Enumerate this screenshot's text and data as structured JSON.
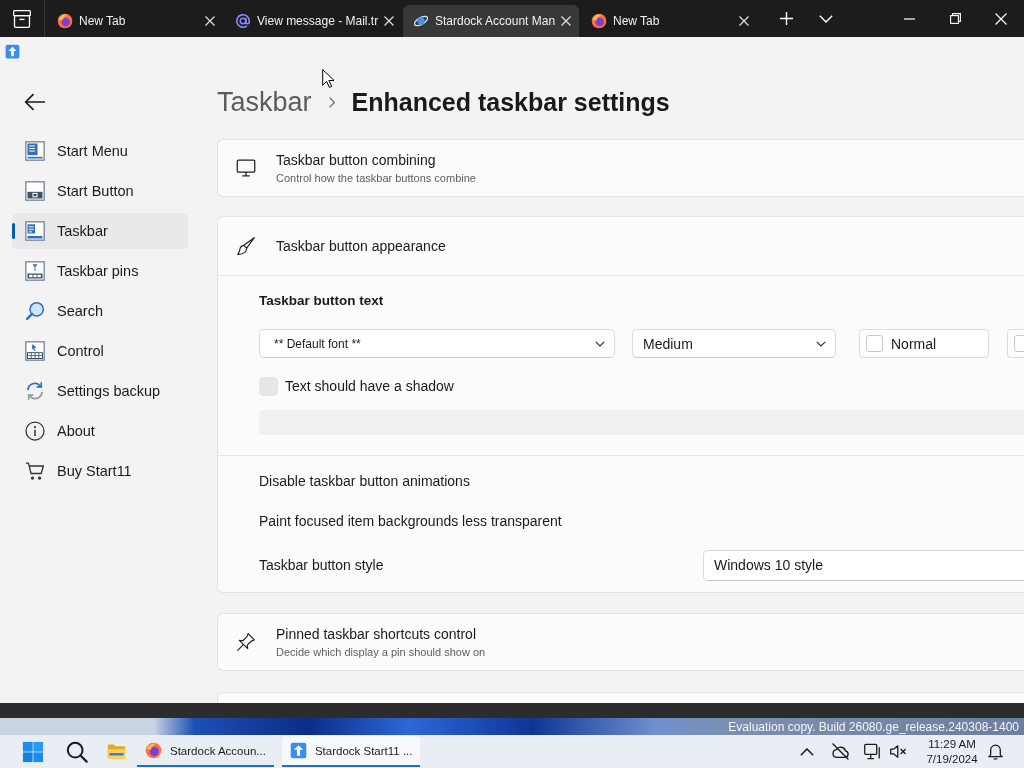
{
  "browser": {
    "tabs": [
      {
        "kind": "fox",
        "title": "New Tab",
        "selected": false
      },
      {
        "kind": "mail",
        "title": "View message - Mail.tr",
        "selected": false
      },
      {
        "kind": "orbit",
        "title": "Stardock Account Man",
        "selected": true
      },
      {
        "kind": "fox",
        "title": "New Tab",
        "selected": false
      }
    ]
  },
  "sidebar": {
    "items": [
      {
        "kind": "start_menu",
        "label": "Start Menu",
        "selected": false
      },
      {
        "kind": "start_button",
        "label": "Start Button",
        "selected": false
      },
      {
        "kind": "taskbar",
        "label": "Taskbar",
        "selected": true
      },
      {
        "kind": "pins",
        "label": "Taskbar pins",
        "selected": false
      },
      {
        "kind": "search",
        "label": "Search",
        "selected": false
      },
      {
        "kind": "control",
        "label": "Control",
        "selected": false
      },
      {
        "kind": "sync",
        "label": "Settings backup",
        "selected": false
      },
      {
        "kind": "info",
        "label": "About",
        "selected": false
      },
      {
        "kind": "cart",
        "label": "Buy Start11",
        "selected": false
      }
    ]
  },
  "breadcrumb": {
    "parent": "Taskbar",
    "current": "Enhanced taskbar settings"
  },
  "cards": [
    {
      "kind": "monitor",
      "title": "Taskbar button combining",
      "subtitle": "Control how the taskbar buttons combine"
    },
    {
      "kind": "brush",
      "title": "Taskbar button appearance",
      "body": {
        "heading": "Taskbar button text",
        "font_dropdown": {
          "value": "** Default font **"
        },
        "size_dropdown": {
          "value": "Medium"
        },
        "style_toggles": [
          {
            "label": "Normal",
            "checked": false
          },
          {
            "checked": false
          }
        ],
        "shadow_checkbox": {
          "label": "Text should have a shadow",
          "checked": false,
          "disabled": true
        },
        "preview_field": {
          "disabled": true
        },
        "options": [
          {
            "kind": "text",
            "label": "Disable taskbar button animations"
          },
          {
            "kind": "text",
            "label": "Paint focused item backgrounds less transparent"
          },
          {
            "kind": "dropdown",
            "label": "Taskbar button style",
            "value": "Windows 10 style"
          }
        ]
      }
    },
    {
      "kind": "pin",
      "title": "Pinned taskbar shortcuts control",
      "subtitle": "Decide which display a pin should show on"
    },
    {
      "kind": "blank"
    }
  ],
  "desktop": {
    "notice": "Evaluation copy. Build 26080.ge_release.240308-1400"
  },
  "taskbar": {
    "apps": [
      {
        "kind": "fox",
        "label": "Stardock Accoun...",
        "selected": false
      },
      {
        "kind": "tile",
        "label": "Stardock Start11 ...",
        "selected": true
      }
    ],
    "time": "11:29 AM",
    "date": "7/19/2024"
  }
}
